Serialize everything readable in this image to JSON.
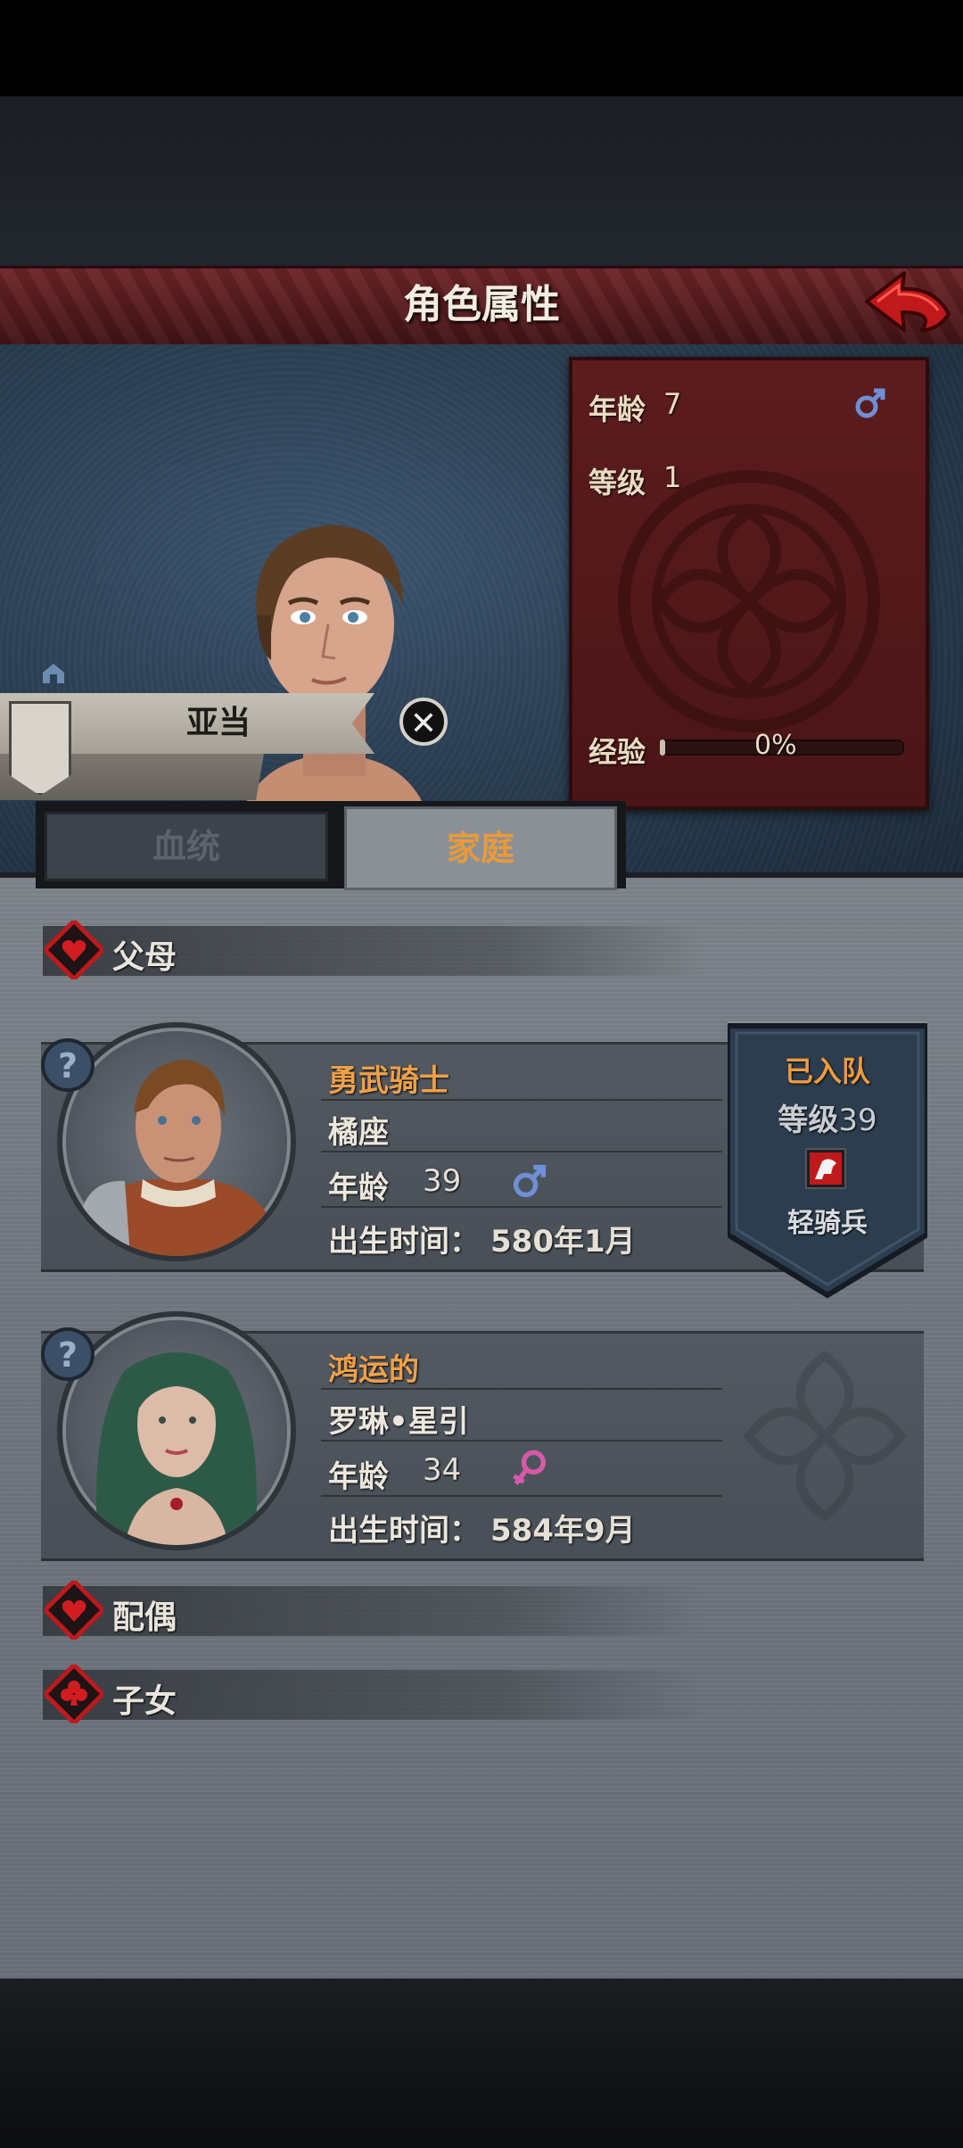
{
  "header": {
    "title": "角色属性"
  },
  "character": {
    "name": "亚当",
    "stats": {
      "age_label": "年龄",
      "age": "7",
      "level_label": "等级",
      "level": "1",
      "xp_label": "经验",
      "xp_text": "0%",
      "xp_progress": 0
    }
  },
  "tabs": [
    {
      "label": "血统",
      "active": false
    },
    {
      "label": "家庭",
      "active": true
    }
  ],
  "sections": {
    "parents": "父母",
    "spouse": "配偶",
    "children": "子女"
  },
  "parents": [
    {
      "title": "勇武骑士",
      "name": "橘座",
      "age_label": "年龄",
      "age": "39",
      "birth_label": "出生时间：",
      "birth": "580年1月",
      "gender": "male",
      "squad": {
        "status": "已入队",
        "level_label": "等级",
        "level": "39",
        "class": "轻骑兵"
      }
    },
    {
      "title": "鸿运的",
      "name": "罗琳•星引",
      "age_label": "年龄",
      "age": "34",
      "birth_label": "出生时间：",
      "birth": "584年9月",
      "gender": "female"
    }
  ],
  "colors": {
    "male": "#6f8fd6",
    "female": "#d45aa8",
    "accent": "#eea04a",
    "banner_red": "#5c1c1e"
  }
}
